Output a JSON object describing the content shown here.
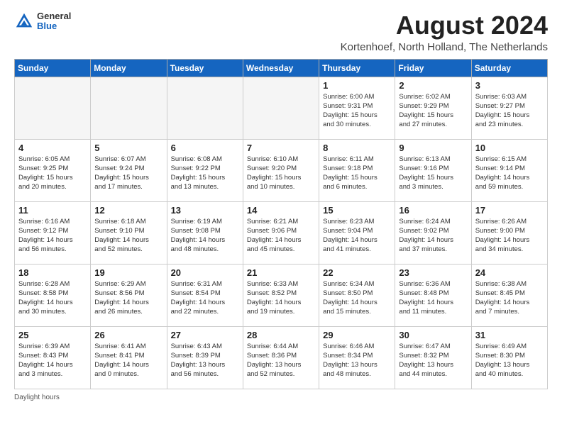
{
  "header": {
    "logo_general": "General",
    "logo_blue": "Blue",
    "month_title": "August 2024",
    "location": "Kortenhoef, North Holland, The Netherlands"
  },
  "days_of_week": [
    "Sunday",
    "Monday",
    "Tuesday",
    "Wednesday",
    "Thursday",
    "Friday",
    "Saturday"
  ],
  "weeks": [
    [
      {
        "day": "",
        "info": ""
      },
      {
        "day": "",
        "info": ""
      },
      {
        "day": "",
        "info": ""
      },
      {
        "day": "",
        "info": ""
      },
      {
        "day": "1",
        "info": "Sunrise: 6:00 AM\nSunset: 9:31 PM\nDaylight: 15 hours\nand 30 minutes."
      },
      {
        "day": "2",
        "info": "Sunrise: 6:02 AM\nSunset: 9:29 PM\nDaylight: 15 hours\nand 27 minutes."
      },
      {
        "day": "3",
        "info": "Sunrise: 6:03 AM\nSunset: 9:27 PM\nDaylight: 15 hours\nand 23 minutes."
      }
    ],
    [
      {
        "day": "4",
        "info": "Sunrise: 6:05 AM\nSunset: 9:25 PM\nDaylight: 15 hours\nand 20 minutes."
      },
      {
        "day": "5",
        "info": "Sunrise: 6:07 AM\nSunset: 9:24 PM\nDaylight: 15 hours\nand 17 minutes."
      },
      {
        "day": "6",
        "info": "Sunrise: 6:08 AM\nSunset: 9:22 PM\nDaylight: 15 hours\nand 13 minutes."
      },
      {
        "day": "7",
        "info": "Sunrise: 6:10 AM\nSunset: 9:20 PM\nDaylight: 15 hours\nand 10 minutes."
      },
      {
        "day": "8",
        "info": "Sunrise: 6:11 AM\nSunset: 9:18 PM\nDaylight: 15 hours\nand 6 minutes."
      },
      {
        "day": "9",
        "info": "Sunrise: 6:13 AM\nSunset: 9:16 PM\nDaylight: 15 hours\nand 3 minutes."
      },
      {
        "day": "10",
        "info": "Sunrise: 6:15 AM\nSunset: 9:14 PM\nDaylight: 14 hours\nand 59 minutes."
      }
    ],
    [
      {
        "day": "11",
        "info": "Sunrise: 6:16 AM\nSunset: 9:12 PM\nDaylight: 14 hours\nand 56 minutes."
      },
      {
        "day": "12",
        "info": "Sunrise: 6:18 AM\nSunset: 9:10 PM\nDaylight: 14 hours\nand 52 minutes."
      },
      {
        "day": "13",
        "info": "Sunrise: 6:19 AM\nSunset: 9:08 PM\nDaylight: 14 hours\nand 48 minutes."
      },
      {
        "day": "14",
        "info": "Sunrise: 6:21 AM\nSunset: 9:06 PM\nDaylight: 14 hours\nand 45 minutes."
      },
      {
        "day": "15",
        "info": "Sunrise: 6:23 AM\nSunset: 9:04 PM\nDaylight: 14 hours\nand 41 minutes."
      },
      {
        "day": "16",
        "info": "Sunrise: 6:24 AM\nSunset: 9:02 PM\nDaylight: 14 hours\nand 37 minutes."
      },
      {
        "day": "17",
        "info": "Sunrise: 6:26 AM\nSunset: 9:00 PM\nDaylight: 14 hours\nand 34 minutes."
      }
    ],
    [
      {
        "day": "18",
        "info": "Sunrise: 6:28 AM\nSunset: 8:58 PM\nDaylight: 14 hours\nand 30 minutes."
      },
      {
        "day": "19",
        "info": "Sunrise: 6:29 AM\nSunset: 8:56 PM\nDaylight: 14 hours\nand 26 minutes."
      },
      {
        "day": "20",
        "info": "Sunrise: 6:31 AM\nSunset: 8:54 PM\nDaylight: 14 hours\nand 22 minutes."
      },
      {
        "day": "21",
        "info": "Sunrise: 6:33 AM\nSunset: 8:52 PM\nDaylight: 14 hours\nand 19 minutes."
      },
      {
        "day": "22",
        "info": "Sunrise: 6:34 AM\nSunset: 8:50 PM\nDaylight: 14 hours\nand 15 minutes."
      },
      {
        "day": "23",
        "info": "Sunrise: 6:36 AM\nSunset: 8:48 PM\nDaylight: 14 hours\nand 11 minutes."
      },
      {
        "day": "24",
        "info": "Sunrise: 6:38 AM\nSunset: 8:45 PM\nDaylight: 14 hours\nand 7 minutes."
      }
    ],
    [
      {
        "day": "25",
        "info": "Sunrise: 6:39 AM\nSunset: 8:43 PM\nDaylight: 14 hours\nand 3 minutes."
      },
      {
        "day": "26",
        "info": "Sunrise: 6:41 AM\nSunset: 8:41 PM\nDaylight: 14 hours\nand 0 minutes."
      },
      {
        "day": "27",
        "info": "Sunrise: 6:43 AM\nSunset: 8:39 PM\nDaylight: 13 hours\nand 56 minutes."
      },
      {
        "day": "28",
        "info": "Sunrise: 6:44 AM\nSunset: 8:36 PM\nDaylight: 13 hours\nand 52 minutes."
      },
      {
        "day": "29",
        "info": "Sunrise: 6:46 AM\nSunset: 8:34 PM\nDaylight: 13 hours\nand 48 minutes."
      },
      {
        "day": "30",
        "info": "Sunrise: 6:47 AM\nSunset: 8:32 PM\nDaylight: 13 hours\nand 44 minutes."
      },
      {
        "day": "31",
        "info": "Sunrise: 6:49 AM\nSunset: 8:30 PM\nDaylight: 13 hours\nand 40 minutes."
      }
    ]
  ],
  "footer": {
    "note": "Daylight hours"
  }
}
